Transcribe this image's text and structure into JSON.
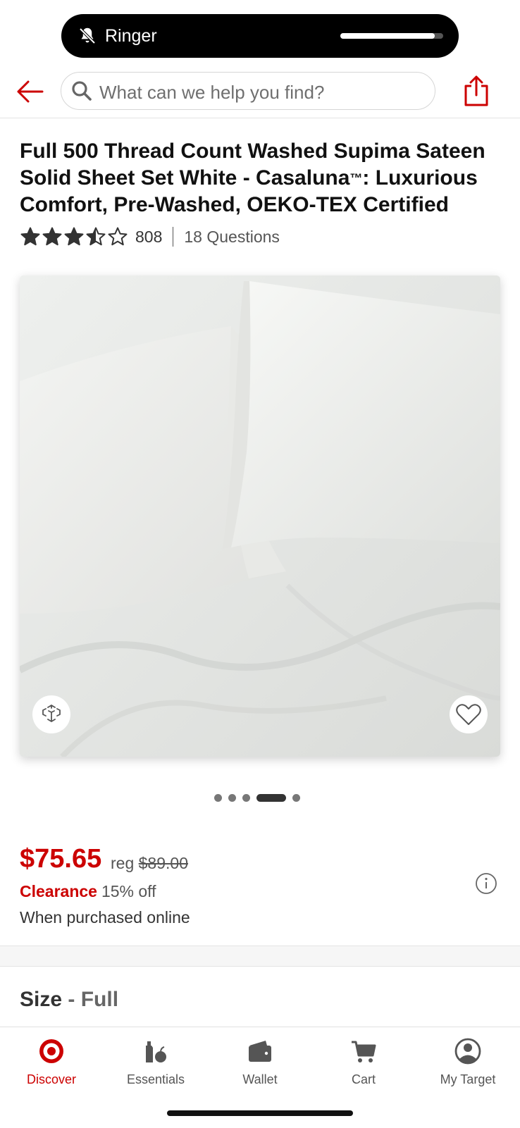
{
  "status": {
    "ringer_label": "Ringer",
    "ringer_volume": 0.92
  },
  "header": {
    "search_placeholder": "What can we help you find?"
  },
  "product": {
    "title": "Full 500 Thread Count Washed Supima Sateen Solid Sheet Set White - Casaluna",
    "title_tm": "™",
    "title_rest": ": Luxurious Comfort, Pre-Washed, OEKO-TEX Certified",
    "rating_value": 3.5,
    "rating_max": 5,
    "review_count": "808",
    "questions": "18 Questions",
    "image_alt": "white sheet set with pillows",
    "carousel_total": 5,
    "carousel_active": 4
  },
  "pricing": {
    "price": "$75.65",
    "reg_label": "reg",
    "reg_price": "$89.00",
    "clearance_label": "Clearance",
    "discount": "15% off",
    "online_note": "When purchased online"
  },
  "size": {
    "label": "Size",
    "separator": " - ",
    "value": "Full"
  },
  "nav": {
    "items": [
      {
        "label": "Discover",
        "icon": "target-icon",
        "active": true
      },
      {
        "label": "Essentials",
        "icon": "essentials-icon",
        "active": false
      },
      {
        "label": "Wallet",
        "icon": "wallet-icon",
        "active": false
      },
      {
        "label": "Cart",
        "icon": "cart-icon",
        "active": false
      },
      {
        "label": "My Target",
        "icon": "account-icon",
        "active": false
      }
    ]
  },
  "colors": {
    "brand_red": "#cc0000",
    "text_dark": "#1f1f1f"
  }
}
